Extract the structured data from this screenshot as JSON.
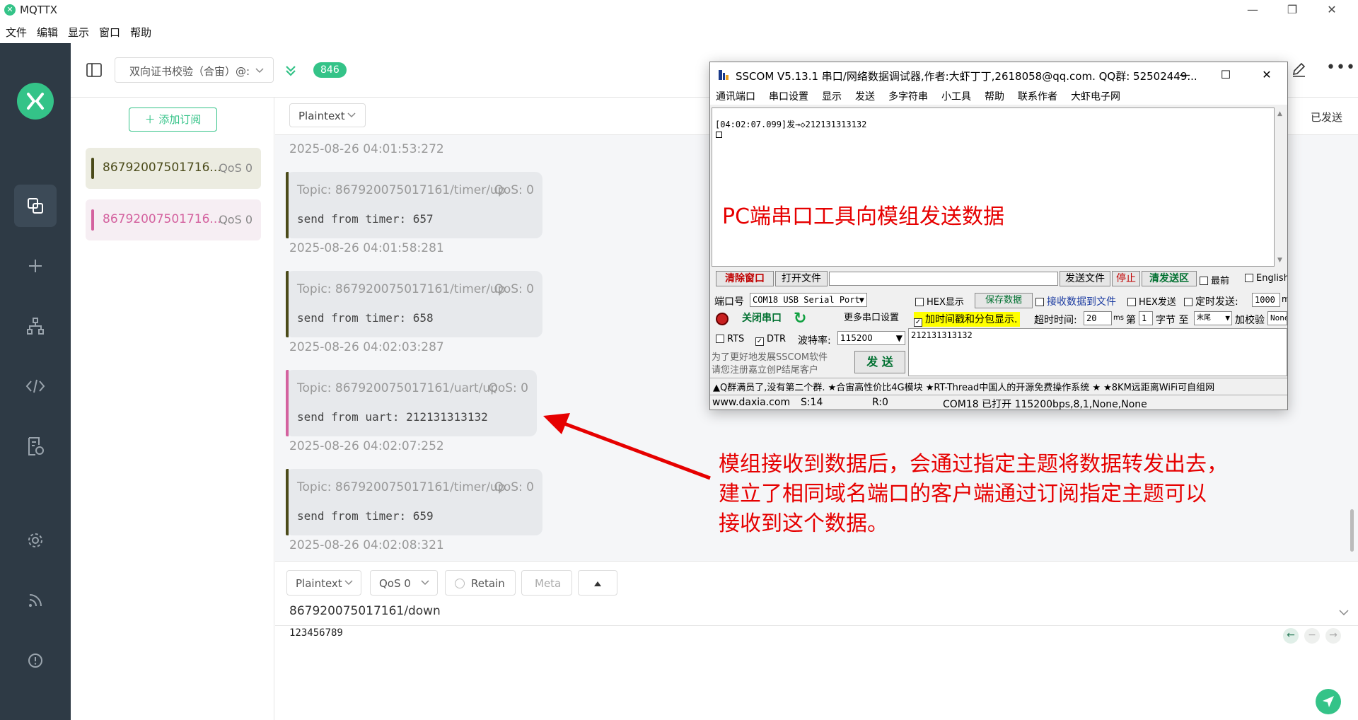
{
  "window": {
    "app_title": "MQTTX",
    "minimize": "—",
    "restore": "❐",
    "close": "✕"
  },
  "menu": [
    "文件",
    "编辑",
    "显示",
    "窗口",
    "帮助"
  ],
  "connection": {
    "name": "双向证书校验（合宙）@:",
    "unread_count": "846"
  },
  "subscriptions": {
    "add_label": "添加订阅",
    "items": [
      {
        "topic": "86792007501716...",
        "qos": "QoS 0",
        "color": "#4b4b1a"
      },
      {
        "topic": "86792007501716...",
        "qos": "QoS 0",
        "color": "#d4629f"
      }
    ]
  },
  "messages": {
    "format": "Plaintext",
    "filter_extra": "t",
    "sent_label": "已发送",
    "top_timestamp": "2025-08-26 04:01:53:272",
    "items": [
      {
        "topic": "Topic: 867920075017161/timer/up",
        "qos": "QoS: 0",
        "payload": "send from timer: 657",
        "time": "2025-08-26 04:01:58:281",
        "color": "#4b4b1a"
      },
      {
        "topic": "Topic: 867920075017161/timer/up",
        "qos": "QoS: 0",
        "payload": "send from timer: 658",
        "time": "2025-08-26 04:02:03:287",
        "color": "#4b4b1a"
      },
      {
        "topic": "Topic: 867920075017161/uart/up",
        "qos": "QoS: 0",
        "payload": "send from uart: 212131313132",
        "time": "2025-08-26 04:02:07:252",
        "color": "#d4629f"
      },
      {
        "topic": "Topic: 867920075017161/timer/up",
        "qos": "QoS: 0",
        "payload": "send from timer: 659",
        "time": "2025-08-26 04:02:08:321",
        "color": "#4b4b1a"
      }
    ]
  },
  "publish": {
    "format": "Plaintext",
    "qos": "QoS 0",
    "retain": "Retain",
    "meta": "Meta",
    "topic": "867920075017161/down",
    "payload": "123456789"
  },
  "sscom": {
    "title": "SSCOM V5.13.1 串口/网络数据调试器,作者:大虾丁丁,2618058@qq.com. QQ群: 52502449...",
    "menu": [
      "通讯端口",
      "串口设置",
      "显示",
      "发送",
      "多字符串",
      "小工具",
      "帮助",
      "联系作者",
      "大虾电子网"
    ],
    "recv_line": "[04:02:07.099]发→◇212131313132",
    "btn_clear": "清除窗口",
    "btn_open_file": "打开文件",
    "btn_send_file": "发送文件",
    "btn_stop": "停止",
    "btn_clear_send": "清发送区",
    "chk_top": "最前",
    "chk_english": "English",
    "lbl_port": "端口号",
    "port_value": "COM18 USB Serial Port",
    "chk_hex_show": "HEX显示",
    "btn_save_data": "保存数据",
    "chk_recv_to_file": "接收数据到文件",
    "chk_hex_send": "HEX发送",
    "chk_timed_send": "定时发送:",
    "timed_value": "1000",
    "timed_unit": "m",
    "btn_close_port": "关闭串口",
    "btn_more_ports": "更多串口设置",
    "chk_timestamp": "加时间戳和分包显示.",
    "lbl_timeout": "超时时间:",
    "timeout_value": "20",
    "timeout_unit": "ms",
    "lbl_no": "第",
    "no_value": "1",
    "lbl_byte": "字节 至",
    "end_value": "末尾",
    "lbl_checksum": "加校验",
    "checksum_value": "None",
    "chk_rts": "RTS",
    "chk_dtr": "DTR",
    "lbl_baud": "波特率:",
    "baud_value": "115200",
    "send_text": "212131313132",
    "promo_line1": "为了更好地发展SSCOM软件",
    "promo_line2": "请您注册嘉立创P结尾客户",
    "btn_send": "发 送",
    "ticker": "▲Q群满员了,没有第二个群. ★合宙高性价比4G模块 ★RT-Thread中国人的开源免费操作系统 ★ ★8KM远距离WiFi可自组网",
    "status_site": "www.daxia.com",
    "status_s": "S:14",
    "status_r": "R:0",
    "status_port": "COM18 已打开  115200bps,8,1,None,None",
    "annotation": "PC端串口工具向模组发送数据"
  },
  "annotation": {
    "line1": "模组接收到数据后，会通过指定主题将数据转发出去，",
    "line2": "建立了相同域名端口的客户端通过订阅指定主题可以",
    "line3": "接收到这个数据。"
  }
}
